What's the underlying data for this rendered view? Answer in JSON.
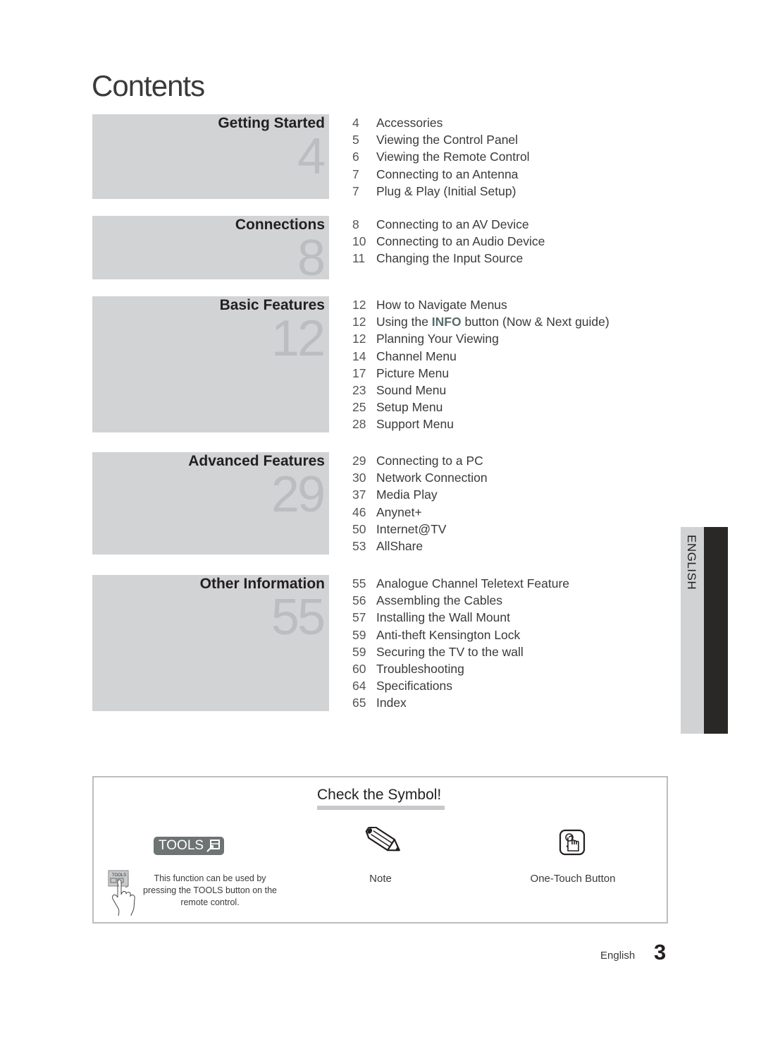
{
  "page": {
    "title": "Contents",
    "language_tab": "ENGLISH",
    "footer_language": "English",
    "page_number": "3"
  },
  "sections": [
    {
      "heading": "Getting Started",
      "start_page": "4",
      "entries": [
        {
          "page": "4",
          "label": "Accessories"
        },
        {
          "page": "5",
          "label": "Viewing the Control Panel"
        },
        {
          "page": "6",
          "label": "Viewing the Remote Control"
        },
        {
          "page": "7",
          "label": "Connecting to an Antenna"
        },
        {
          "page": "7",
          "label": "Plug & Play (Initial Setup)"
        }
      ]
    },
    {
      "heading": "Connections",
      "start_page": "8",
      "entries": [
        {
          "page": "8",
          "label": "Connecting to an AV Device"
        },
        {
          "page": "10",
          "label": "Connecting to an Audio Device"
        },
        {
          "page": "11",
          "label": "Changing the Input Source"
        }
      ]
    },
    {
      "heading": "Basic Features",
      "start_page": "12",
      "entries": [
        {
          "page": "12",
          "label": "How to Navigate Menus"
        },
        {
          "page": "12",
          "label_pre": "Using the ",
          "label_highlight": "INFO",
          "label_post": " button (Now & Next guide)"
        },
        {
          "page": "12",
          "label": "Planning Your Viewing"
        },
        {
          "page": "14",
          "label": "Channel Menu"
        },
        {
          "page": "17",
          "label": "Picture Menu"
        },
        {
          "page": "23",
          "label": "Sound Menu"
        },
        {
          "page": "25",
          "label": "Setup Menu"
        },
        {
          "page": "28",
          "label": "Support Menu"
        }
      ]
    },
    {
      "heading": "Advanced Features",
      "start_page": "29",
      "entries": [
        {
          "page": "29",
          "label": "Connecting to a PC"
        },
        {
          "page": "30",
          "label": "Network Connection"
        },
        {
          "page": "37",
          "label": "Media Play"
        },
        {
          "page": "46",
          "label": "Anynet+"
        },
        {
          "page": "50",
          "label": "Internet@TV"
        },
        {
          "page": "53",
          "label": "AllShare"
        }
      ]
    },
    {
      "heading": "Other Information",
      "start_page": "55",
      "entries": [
        {
          "page": "55",
          "label": "Analogue Channel Teletext Feature"
        },
        {
          "page": "56",
          "label": "Assembling the Cables"
        },
        {
          "page": "57",
          "label": "Installing the Wall Mount"
        },
        {
          "page": "59",
          "label": "Anti-theft Kensington Lock"
        },
        {
          "page": "59",
          "label": "Securing the TV to the wall"
        },
        {
          "page": "60",
          "label": "Troubleshooting"
        },
        {
          "page": "64",
          "label": "Specifications"
        },
        {
          "page": "65",
          "label": "Index"
        }
      ]
    }
  ],
  "symbols": {
    "title": "Check the Symbol!",
    "tools": {
      "badge_label": "TOOLS",
      "icon": "tools-arrow-icon",
      "mini_label": "TOOLS",
      "description_line1": "This function can be used by",
      "description_line2_pre": "pressing the ",
      "description_line2_highlight": "TOOLS",
      "description_line2_post": " button on the",
      "description_line3": "remote control."
    },
    "note": {
      "icon": "pencil-icon",
      "label": "Note"
    },
    "one_touch": {
      "icon": "finger-press-icon",
      "label": "One-Touch Button"
    }
  },
  "colors": {
    "section_bg": "#d2d3d5",
    "section_number": "#bcbdc0",
    "info_highlight": "#5a6c6c",
    "tab_dark": "#2a2727",
    "tools_badge": "#6e7373"
  }
}
